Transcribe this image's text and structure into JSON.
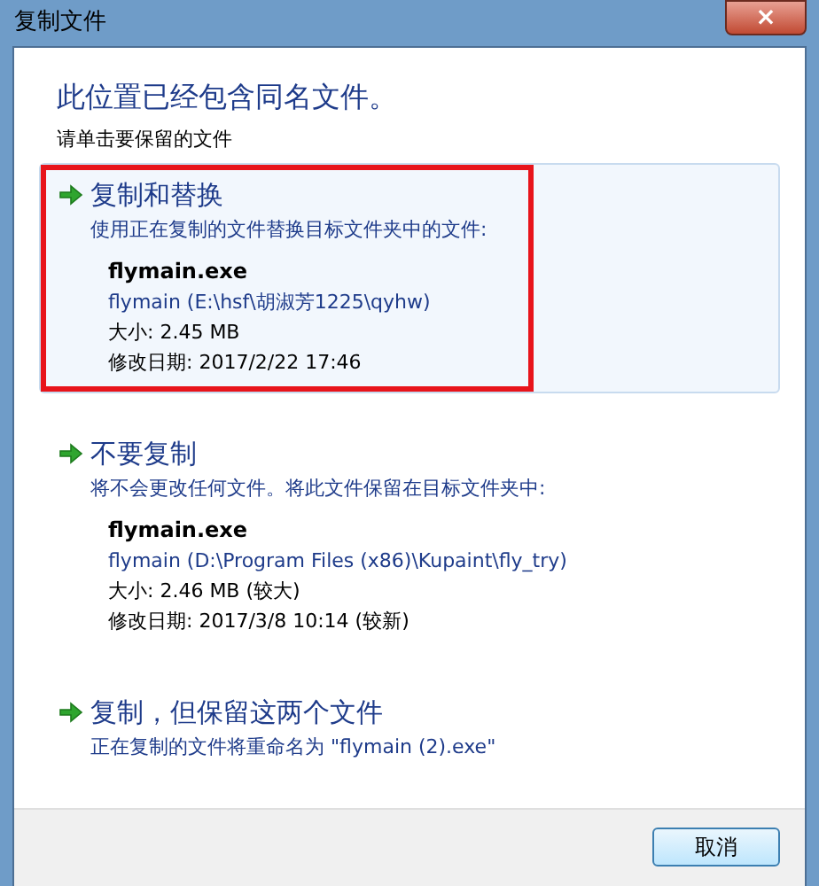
{
  "window": {
    "title": "复制文件",
    "close": "×"
  },
  "heading": "此位置已经包含同名文件。",
  "instruction": "请单击要保留的文件",
  "options": [
    {
      "title": "复制和替换",
      "description": "使用正在复制的文件替换目标文件夹中的文件:",
      "selected": true,
      "file": {
        "name": "flymain.exe",
        "path": "flymain (E:\\hsf\\胡淑芳1225\\qyhw)",
        "size": "大小: 2.45 MB",
        "modified": "修改日期: 2017/2/22 17:46"
      }
    },
    {
      "title": "不要复制",
      "description": "将不会更改任何文件。将此文件保留在目标文件夹中:",
      "selected": false,
      "file": {
        "name": "flymain.exe",
        "path": "flymain (D:\\Program Files (x86)\\Kupaint\\fly_try)",
        "size": "大小: 2.46 MB (较大)",
        "modified": "修改日期: 2017/3/8 10:14 (较新)"
      }
    },
    {
      "title": "复制，但保留这两个文件",
      "description": "正在复制的文件将重命名为 \"flymain (2).exe\"",
      "selected": false
    }
  ],
  "buttons": [
    "取消"
  ]
}
